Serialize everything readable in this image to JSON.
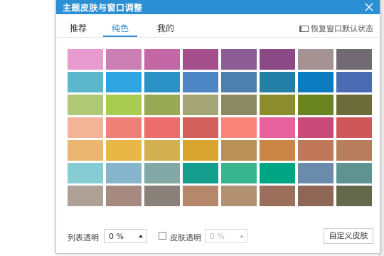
{
  "window": {
    "title": "主题皮肤与窗口调整"
  },
  "tabs": [
    {
      "label": "推荐",
      "active": false
    },
    {
      "label": "纯色",
      "active": true
    },
    {
      "label": "我的",
      "active": false
    }
  ],
  "restore_label": "恢复窗口默认状态",
  "swatches": [
    [
      "#e89bcf",
      "#cc7fb5",
      "#c368a5",
      "#a64f8d",
      "#8c5c94",
      "#8b4a86",
      "#a59292",
      "#726a72"
    ],
    [
      "#5cb6cc",
      "#2fa6e2",
      "#2a92c7",
      "#4e86c6",
      "#4e80ad",
      "#247fa6",
      "#0c7bbf",
      "#4b6ab4"
    ],
    [
      "#b1c877",
      "#a8cc52",
      "#98a853",
      "#a4a576",
      "#8b8a64",
      "#8b8d2c",
      "#6b8422",
      "#6c6c3b"
    ],
    [
      "#f2b396",
      "#ef8078",
      "#ec6d6c",
      "#d2605d",
      "#f98579",
      "#e7629c",
      "#ca4a77",
      "#cd5759"
    ],
    [
      "#ebb670",
      "#e9b746",
      "#d3b04f",
      "#d8a52f",
      "#b99158",
      "#ca8445",
      "#c07858",
      "#b77d5c"
    ],
    [
      "#86ccd3",
      "#88b5ce",
      "#83a9a7",
      "#129d8d",
      "#38b58f",
      "#00a584",
      "#6b8bac",
      "#5e9391"
    ],
    [
      "#aea094",
      "#a68a80",
      "#898079",
      "#b5876b",
      "#b29172",
      "#9b6f5b",
      "#906757",
      "#65694c"
    ]
  ],
  "footer": {
    "list_label": "列表透明",
    "list_value": "0 %",
    "skin_label": "皮肤透明",
    "skin_value": "0 %",
    "skin_checked": false,
    "custom_label": "自定义皮肤"
  }
}
